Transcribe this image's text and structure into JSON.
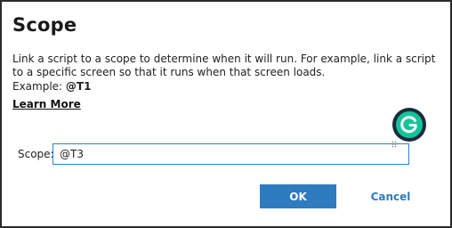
{
  "dialog": {
    "title": "Scope",
    "description": "Link a script to a scope to determine when it will run. For example, link a script to a specific screen so that it runs when that screen loads.",
    "example_prefix": "Example: ",
    "example_value": "@T1",
    "learn_more_label": "Learn More",
    "scope_label": "Scope:",
    "scope_value": "@T3",
    "ok_label": "OK",
    "cancel_label": "Cancel"
  },
  "colors": {
    "primary": "#2f7bc0",
    "input_border": "#2d7fcf",
    "grammarly_green": "#15c39a",
    "grammarly_ring": "#1a2b3c"
  },
  "icons": {
    "grammarly": "grammarly-icon",
    "drag_handle": "drag-handle-icon"
  }
}
